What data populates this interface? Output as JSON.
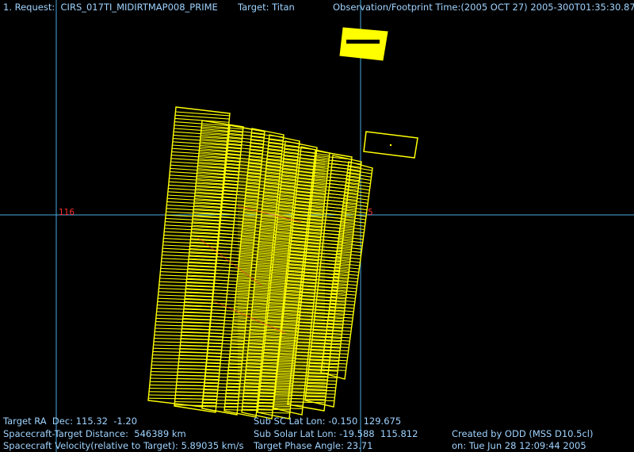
{
  "header": {
    "request": "1. Request:  CIRS_017TI_MIDIRTMAP008_PRIME",
    "target": "Target: Titan",
    "time": "Observation/Footprint Time:(2005 OCT 27) 2005-300T01:35:30.87"
  },
  "axis_ticks": {
    "left": "116",
    "right": "5"
  },
  "footer": {
    "ra_dec": "Target RA  Dec: 115.32  -1.20",
    "distance": "Spacecraft-Target Distance:  546389 km",
    "velocity": "Spacecraft Velocity(relative to Target): 5.89035 km/s",
    "sub_sc": "Sub SC Lat Lon: -0.150  129.675",
    "sub_solar": "Sub Solar Lat Lon: -19.588  115.812",
    "phase": "Target Phase Angle: 23.71",
    "created_by": "Created by ODD (MSS D10.5cl)",
    "created_on": "on: Tue Jun 28 12:09:44 2005"
  },
  "colors": {
    "background": "#000000",
    "text": "#9fd3ff",
    "crosshair": "#4aa8e0",
    "footprint": "#ffff00",
    "tick": "#ff3030",
    "target_detail": "#ff3030"
  }
}
